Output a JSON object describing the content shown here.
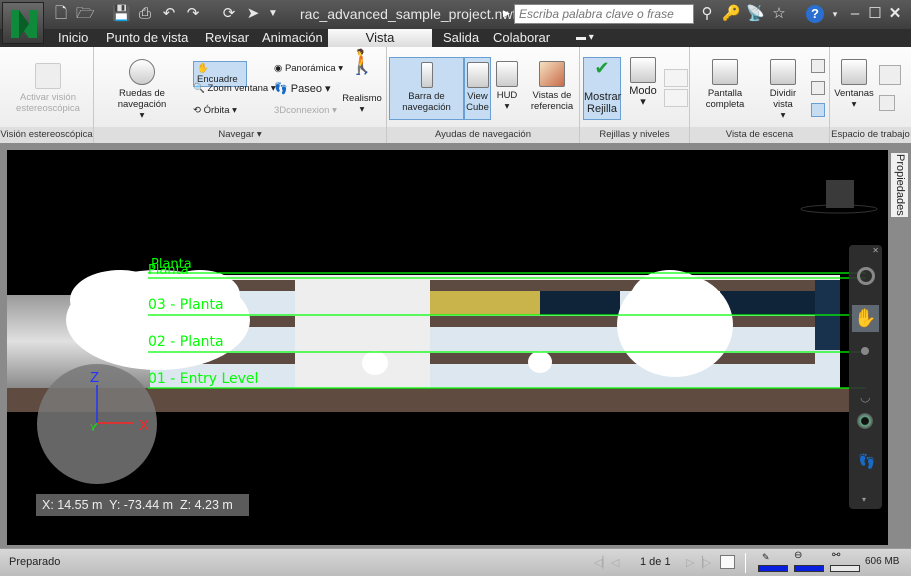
{
  "window": {
    "title": "rac_advanced_sample_project.nwf",
    "search_placeholder": "Escriba palabra clave o frase",
    "help": "?"
  },
  "tabs": [
    {
      "label": "Inicio"
    },
    {
      "label": "Punto de vista"
    },
    {
      "label": "Revisar"
    },
    {
      "label": "Animación"
    },
    {
      "label": "Vista",
      "active": true
    },
    {
      "label": "Salida"
    },
    {
      "label": "Colaborar"
    }
  ],
  "ribbon": {
    "stereo": {
      "button": "Activar visión estereoscópica",
      "label": "Visión estereoscópica"
    },
    "navigate": {
      "wheels": "Ruedas de navegación",
      "pan": "Encuadre",
      "zoom": "Zoom ventana",
      "orbit": "Órbita",
      "panoramic": "Panorámica",
      "walk": "Paseo",
      "connexion": "3Dconnexion",
      "realism": "Realismo",
      "label": "Navegar"
    },
    "navaids": {
      "navbar": "Barra de navegación",
      "viewcube": "View Cube",
      "hud": "HUD",
      "refviews": "Vistas de referencia",
      "label": "Ayudas de navegación"
    },
    "grids": {
      "show": "Mostrar Rejilla",
      "mode": "Modo",
      "label": "Rejillas y niveles"
    },
    "scene": {
      "fullscreen": "Pantalla completa",
      "split": "Dividir vista",
      "label": "Vista de escena"
    },
    "workspace": {
      "windows": "Ventanas",
      "label": "Espacio de trabajo"
    }
  },
  "viewport": {
    "levels": [
      "Planta",
      "Planta",
      "03 - Planta",
      "02 - Planta",
      "01 - Entry Level"
    ],
    "axes": {
      "x": "X",
      "y": "Y",
      "z": "Z"
    },
    "coordinates": "X: 14.55 m  Y: -73.44 m  Z: 4.23 m",
    "level_color": "#00ff00"
  },
  "properties_tab": "Propiedades",
  "status": {
    "text": "Preparado",
    "page": "1 de 1",
    "memory": "606 MB",
    "bar_color": "#0a1ee0"
  }
}
